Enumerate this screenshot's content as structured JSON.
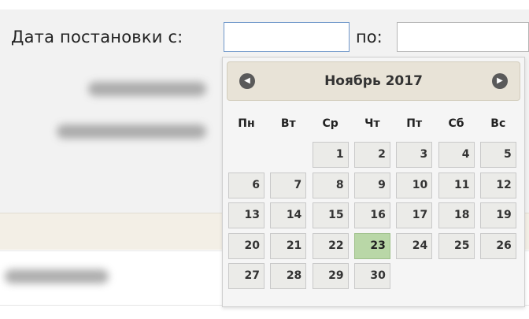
{
  "filter": {
    "date_from_label": "Дата постановки с:",
    "date_from_value": "",
    "date_to_label": "по:",
    "date_to_value": ""
  },
  "datepicker": {
    "prev_icon": "chevron-left-icon",
    "next_icon": "chevron-right-icon",
    "title": "Ноябрь 2017",
    "weekdays": [
      "Пн",
      "Вт",
      "Ср",
      "Чт",
      "Пт",
      "Сб",
      "Вс"
    ],
    "days": [
      "1",
      "2",
      "3",
      "4",
      "5",
      "6",
      "7",
      "8",
      "9",
      "10",
      "11",
      "12",
      "13",
      "14",
      "15",
      "16",
      "17",
      "18",
      "19",
      "20",
      "21",
      "22",
      "23",
      "24",
      "25",
      "26",
      "27",
      "28",
      "29",
      "30"
    ],
    "first_weekday_index": 2,
    "today": "23",
    "colors": {
      "today_bg": "#b9d7a7",
      "day_bg": "#ebebe8",
      "header_bg": "#e8e3d7"
    }
  }
}
